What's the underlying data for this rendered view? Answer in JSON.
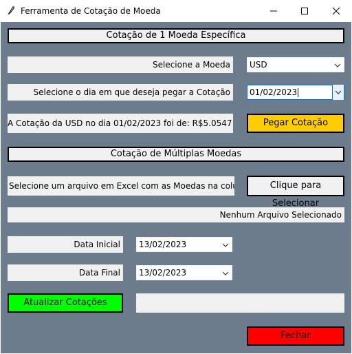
{
  "window": {
    "title": "Ferramenta de Cotação de Moeda"
  },
  "section1": {
    "header": "Cotação de 1 Moeda Específica",
    "currency_label": "Selecione a Moeda",
    "currency_value": "USD",
    "date_label": "Selecione o dia em que deseja pegar a Cotação",
    "date_value": "01/02/2023",
    "result_text": "A Cotação da USD no dia 01/02/2023 foi de: R$5.0547",
    "get_button": "Pegar Cotação"
  },
  "section2": {
    "header": "Cotação de Múltiplas Moedas",
    "file_label": "Selecione um arquivo em Excel com as Moedas na coluna A:",
    "select_button": "Clique para Selecionar",
    "file_status": "Nenhum Arquivo Selecionado",
    "start_label": "Data Inicial",
    "start_value": "13/02/2023",
    "end_label": "Data Final",
    "end_value": "13/02/2023",
    "update_button": "Atualizar Cotações",
    "update_status": ""
  },
  "close_button": "Fechar",
  "colors": {
    "background": "#6c7c8c",
    "get_button": "#ffcc00",
    "update_button": "#00ff00",
    "close_button": "#ff0000"
  }
}
